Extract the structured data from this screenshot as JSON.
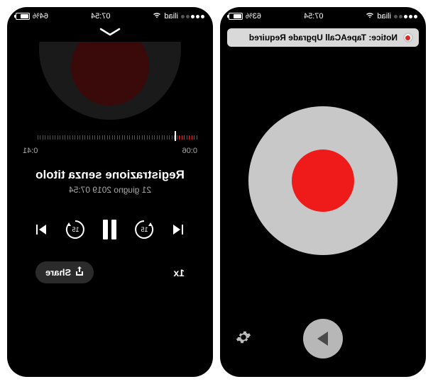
{
  "left": {
    "status": {
      "carrier": "iliad",
      "time": "07:54",
      "battery_pct": "64%"
    },
    "playback": {
      "elapsed": "0:06",
      "remaining": "0:41",
      "progress_pct": 12
    },
    "track": {
      "title": "Registrazione senza titolo",
      "subtitle": "21 giugno 2019 07:54"
    },
    "controls": {
      "seek_back_sec": "15",
      "seek_fwd_sec": "15",
      "speed_label": "1x",
      "share_label": "Share"
    }
  },
  "right": {
    "status": {
      "carrier": "iliad",
      "time": "07:54",
      "battery_pct": "63%"
    },
    "notice": {
      "text": "Notice: TapeACall Upgrade Required"
    }
  },
  "colors": {
    "accent_red": "#ef1a1a",
    "bg": "#000000",
    "grey_button": "#c8c8c8"
  }
}
